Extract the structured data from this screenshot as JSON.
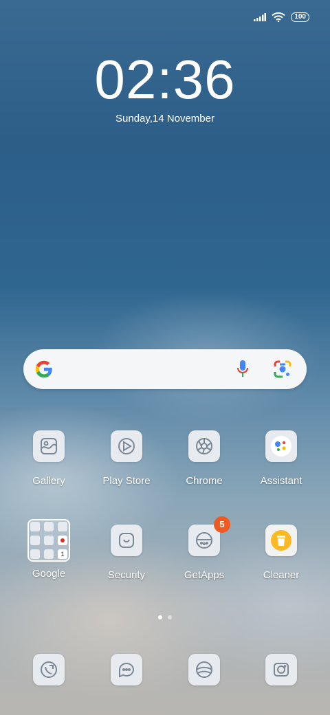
{
  "status_bar": {
    "battery": "100"
  },
  "lock": {
    "time": "02:36",
    "date": "Sunday,14 November"
  },
  "search": {
    "logo_icon": "google-g-icon",
    "mic_icon": "mic-icon",
    "lens_icon": "google-lens-icon"
  },
  "apps_row1": [
    {
      "label": "Gallery",
      "icon": "gallery-icon"
    },
    {
      "label": "Play Store",
      "icon": "play-store-icon"
    },
    {
      "label": "Chrome",
      "icon": "chrome-icon"
    },
    {
      "label": "Assistant",
      "icon": "assistant-icon"
    }
  ],
  "apps_row2": [
    {
      "label": "Google",
      "icon": "folder-icon"
    },
    {
      "label": "Security",
      "icon": "security-icon"
    },
    {
      "label": "GetApps",
      "icon": "getapps-icon",
      "badge": "5"
    },
    {
      "label": "Cleaner",
      "icon": "cleaner-icon"
    }
  ],
  "page_indicator": {
    "pages": 2,
    "current": 1
  },
  "dock": [
    {
      "icon": "phone-icon"
    },
    {
      "icon": "messages-icon"
    },
    {
      "icon": "browser-icon"
    },
    {
      "icon": "camera-icon"
    }
  ],
  "colors": {
    "badge": "#f05a22",
    "tile": "#e7eaee",
    "icon_stroke": "#7a8794"
  }
}
